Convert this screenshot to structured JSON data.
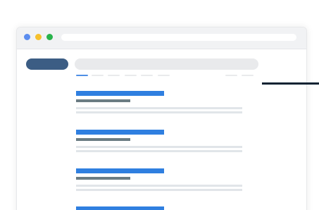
{
  "theme": {
    "brand_color": "#3c5d84",
    "link_color": "#2f7fe0",
    "url_color": "#6b7c83",
    "placeholder_color": "#e9eaec",
    "active_tab_color": "#4f8fe5",
    "pointer_color": "#0d2232"
  },
  "window_controls": [
    {
      "name": "close-dot",
      "color": "#5b8def"
    },
    {
      "name": "minimize-dot",
      "color": "#f6c02c"
    },
    {
      "name": "maximize-dot",
      "color": "#28b34b"
    }
  ],
  "address_bar": {
    "value": ""
  },
  "search": {
    "value": ""
  },
  "tabs": {
    "count": 6,
    "active_index": 0,
    "right_tabs_count": 2
  },
  "results": [
    {
      "title": "",
      "url": "",
      "snippet": [
        "",
        ""
      ]
    },
    {
      "title": "",
      "url": "",
      "snippet": [
        "",
        ""
      ]
    },
    {
      "title": "",
      "url": "",
      "snippet": [
        "",
        ""
      ]
    },
    {
      "title": "",
      "url": "",
      "snippet": []
    }
  ],
  "icons": [
    "pointer-line"
  ]
}
